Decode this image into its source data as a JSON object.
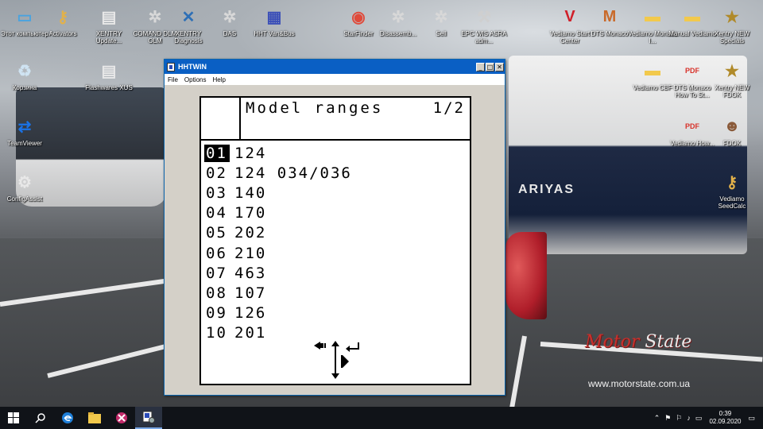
{
  "desktop": {
    "icons": [
      {
        "label": "Этот компьютер",
        "icon": "computer-icon",
        "color": "#4aa3df",
        "glyph": "▭"
      },
      {
        "label": "Activators",
        "icon": "key-icon",
        "color": "#e2b14a",
        "glyph": "⚷"
      },
      {
        "label": "XENTRY Update...",
        "icon": "xentry-update-icon",
        "color": "#e8e8e8",
        "glyph": "▤"
      },
      {
        "label": "COMAND DLM OLM",
        "icon": "mercedes-star-icon",
        "color": "#d8d8d8",
        "glyph": "✲"
      },
      {
        "label": "XENTRY Diagnosis",
        "icon": "xentry-diagnosis-icon",
        "color": "#2d6fb6",
        "glyph": "✕"
      },
      {
        "label": "DAS",
        "icon": "mercedes-star-icon",
        "color": "#d8d8d8",
        "glyph": "✲"
      },
      {
        "label": "HHT Van&Bus",
        "icon": "hht-icon",
        "color": "#3b4fb8",
        "glyph": "▦"
      },
      {
        "label": "StarFinder",
        "icon": "starfinder-icon",
        "color": "#e04a3a",
        "glyph": "◉"
      },
      {
        "label": "Disassemb...",
        "icon": "mercedes-star-icon",
        "color": "#d8d8d8",
        "glyph": "✲"
      },
      {
        "label": "Sell",
        "icon": "mercedes-star-icon",
        "color": "#d8d8d8",
        "glyph": "✲"
      },
      {
        "label": "EPC WIS ASRA adm...",
        "icon": "tools-icon",
        "color": "#cfcfcf",
        "glyph": "⚒"
      },
      {
        "label": "Vediamo Start Center",
        "icon": "vediamo-icon",
        "color": "#d0202a",
        "glyph": "V"
      },
      {
        "label": "DTS Monaco",
        "icon": "dts-monaco-icon",
        "color": "#c96a2a",
        "glyph": "M"
      },
      {
        "label": "Vediamo Monaco I...",
        "icon": "folder-icon",
        "color": "#f2c94c",
        "glyph": "▬"
      },
      {
        "label": "Manual Vediamo",
        "icon": "folder-icon",
        "color": "#f2c94c",
        "glyph": "▬"
      },
      {
        "label": "Xentry NEW Specials",
        "icon": "xentry-new-icon",
        "color": "#b08a2a",
        "glyph": "★"
      },
      {
        "label": "Корзина",
        "icon": "recycle-bin-icon",
        "color": "#cfe3f2",
        "glyph": "♻"
      },
      {
        "label": "Flashwares XUS",
        "icon": "flashwares-icon",
        "color": "#e8e8e8",
        "glyph": "▤"
      },
      {
        "label": "Vediamo CBF",
        "icon": "folder-icon",
        "color": "#f2c94c",
        "glyph": "▬"
      },
      {
        "label": "DTS Monaco How To St...",
        "icon": "pdf-icon",
        "color": "#d8322a",
        "glyph": "PDF"
      },
      {
        "label": "Xentry NEW FDOK",
        "icon": "xentry-new-icon",
        "color": "#b08a2a",
        "glyph": "★"
      },
      {
        "label": "TeamViewer",
        "icon": "teamviewer-icon",
        "color": "#1a73e8",
        "glyph": "⇄"
      },
      {
        "label": "Vediamo How...",
        "icon": "pdf-icon",
        "color": "#d8322a",
        "glyph": "PDF"
      },
      {
        "label": "FDOK",
        "icon": "fdok-icon",
        "color": "#8a5a3a",
        "glyph": "☻"
      },
      {
        "label": "ConfigAssist",
        "icon": "config-assist-icon",
        "color": "#e8e8e8",
        "glyph": "⚙"
      },
      {
        "label": "Vediamo SeedCalc",
        "icon": "seedcalc-icon",
        "color": "#e2b14a",
        "glyph": "⚷"
      }
    ],
    "wallpaper": {
      "boat_name": "ARIYAS",
      "brand_part1": "Motor",
      "brand_part2": "State",
      "url": "www.motorstate.com.ua"
    }
  },
  "window": {
    "title": "HHTWIN",
    "menu": [
      "File",
      "Options",
      "Help"
    ],
    "controls": {
      "minimize": "_",
      "maximize": "□",
      "close": "✕"
    },
    "lcd": {
      "title": "Model ranges",
      "page": "1/2",
      "selected_index": 0,
      "rows": [
        {
          "num": "01",
          "value": "124"
        },
        {
          "num": "02",
          "value": "124 034/036"
        },
        {
          "num": "03",
          "value": "140"
        },
        {
          "num": "04",
          "value": "170"
        },
        {
          "num": "05",
          "value": "202"
        },
        {
          "num": "06",
          "value": "210"
        },
        {
          "num": "07",
          "value": "463"
        },
        {
          "num": "08",
          "value": "107"
        },
        {
          "num": "09",
          "value": "126"
        },
        {
          "num": "10",
          "value": "201"
        }
      ],
      "soft_keys": [
        "back-arrow-icon",
        "up-down-arrow-icon",
        "enter-icon"
      ]
    }
  },
  "taskbar": {
    "items": [
      "start-icon",
      "search-icon",
      "edge-icon",
      "file-explorer-icon",
      "app-icon",
      "hhtwin-task-icon"
    ],
    "clock_time": "0:39",
    "clock_date": "02.09.2020",
    "tray_icons": [
      "chevron-up-icon",
      "network-icon",
      "language-icon",
      "volume-icon",
      "power-icon",
      "notifications-icon"
    ]
  }
}
